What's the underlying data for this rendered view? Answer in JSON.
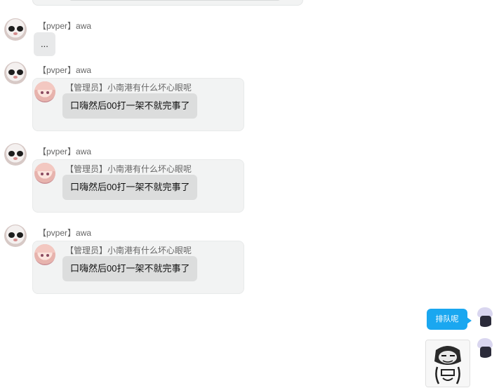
{
  "messages": [
    {
      "sender": "【pvper】awa",
      "text": "..."
    },
    {
      "sender": "【pvper】awa",
      "quote": {
        "name": "【管理员】小南港有什么坏心眼呢",
        "text": "口嗨然后00打一架不就完事了"
      }
    },
    {
      "sender": "【pvper】awa",
      "quote": {
        "name": "【管理员】小南港有什么坏心眼呢",
        "text": "口嗨然后00打一架不就完事了"
      }
    },
    {
      "sender": "【pvper】awa",
      "quote": {
        "name": "【管理员】小南港有什么坏心眼呢",
        "text": "口嗨然后00打一架不就完事了"
      }
    }
  ],
  "mine": {
    "text": "排队呢"
  },
  "colors": {
    "mine_bubble": "#1aa7f0",
    "quote_bg": "#f2f3f3",
    "bubble_gray": "#e8e9ea"
  },
  "icons": {
    "sticker": "meme-sticker-icon"
  }
}
